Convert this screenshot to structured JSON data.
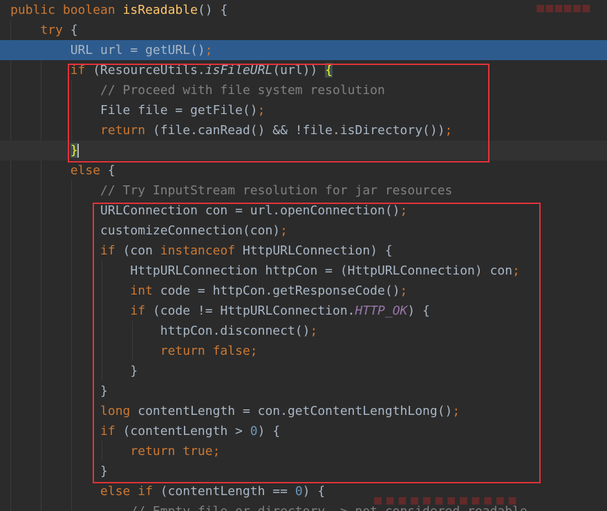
{
  "editor": {
    "lines": [
      [
        [
          "kw",
          "public "
        ],
        [
          "kw",
          "boolean "
        ],
        [
          "fn",
          "isReadable"
        ],
        [
          "",
          "() {"
        ]
      ],
      [
        [
          "kw",
          "    try "
        ],
        [
          "",
          "{"
        ]
      ],
      [
        [
          "",
          "        URL url = getURL()"
        ],
        [
          "punc",
          ";"
        ]
      ],
      [
        [
          "kw",
          "        if "
        ],
        [
          "",
          "(ResourceUtils."
        ],
        [
          "it",
          "isFileURL"
        ],
        [
          "",
          "(url)) "
        ],
        [
          "brace-hl",
          "{"
        ]
      ],
      [
        [
          "cm",
          "            // Proceed with file system resolution"
        ]
      ],
      [
        [
          "",
          "            File file = getFile()"
        ],
        [
          "punc",
          ";"
        ]
      ],
      [
        [
          "kw",
          "            return "
        ],
        [
          "",
          "(file.canRead() && !file.isDirectory())"
        ],
        [
          "punc",
          ";"
        ]
      ],
      [
        [
          "",
          "        "
        ],
        [
          "brace-hl",
          "}"
        ],
        [
          "caret",
          ""
        ]
      ],
      [
        [
          "kw",
          "        else "
        ],
        [
          "",
          "{"
        ]
      ],
      [
        [
          "cm",
          "            // Try InputStream resolution for jar resources"
        ]
      ],
      [
        [
          "",
          "            URLConnection con = url.openConnection()"
        ],
        [
          "punc",
          ";"
        ]
      ],
      [
        [
          "",
          "            customizeConnection(con)"
        ],
        [
          "punc",
          ";"
        ]
      ],
      [
        [
          "kw",
          "            if "
        ],
        [
          "",
          "(con "
        ],
        [
          "kw",
          "instanceof "
        ],
        [
          "",
          "HttpURLConnection) {"
        ]
      ],
      [
        [
          "",
          "                HttpURLConnection httpCon = (HttpURLConnection) con"
        ],
        [
          "punc",
          ";"
        ]
      ],
      [
        [
          "kw",
          "                int "
        ],
        [
          "",
          "code = httpCon.getResponseCode()"
        ],
        [
          "punc",
          ";"
        ]
      ],
      [
        [
          "kw",
          "                if "
        ],
        [
          "",
          "(code != HttpURLConnection."
        ],
        [
          "st",
          "HTTP_OK"
        ],
        [
          "",
          ") {"
        ]
      ],
      [
        [
          "",
          "                    httpCon.disconnect()"
        ],
        [
          "punc",
          ";"
        ]
      ],
      [
        [
          "kw",
          "                    return false"
        ],
        [
          "punc",
          ";"
        ]
      ],
      [
        [
          "",
          "                }"
        ]
      ],
      [
        [
          "",
          "            }"
        ]
      ],
      [
        [
          "kw",
          "            long "
        ],
        [
          "",
          "contentLength = con.getContentLengthLong()"
        ],
        [
          "punc",
          ";"
        ]
      ],
      [
        [
          "kw",
          "            if "
        ],
        [
          "",
          "(contentLength > "
        ],
        [
          "nm",
          "0"
        ],
        [
          "",
          ") {"
        ]
      ],
      [
        [
          "kw",
          "                return true"
        ],
        [
          "punc",
          ";"
        ]
      ],
      [
        [
          "",
          "            }"
        ]
      ],
      [
        [
          "kw",
          "            else if "
        ],
        [
          "",
          "(contentLength == "
        ],
        [
          "nm",
          "0"
        ],
        [
          "",
          ") {"
        ]
      ],
      [
        [
          "cm",
          "                // Empty file or directory -> not considered readable..."
        ]
      ]
    ]
  },
  "colors": {
    "background": "#2b2b2b",
    "selection": "#2d5b8e",
    "keyword": "#cc7832",
    "function": "#ffc66d",
    "comment": "#808080",
    "number": "#6897bb",
    "static_field": "#9876aa",
    "annotation_box": "#e3323a"
  }
}
